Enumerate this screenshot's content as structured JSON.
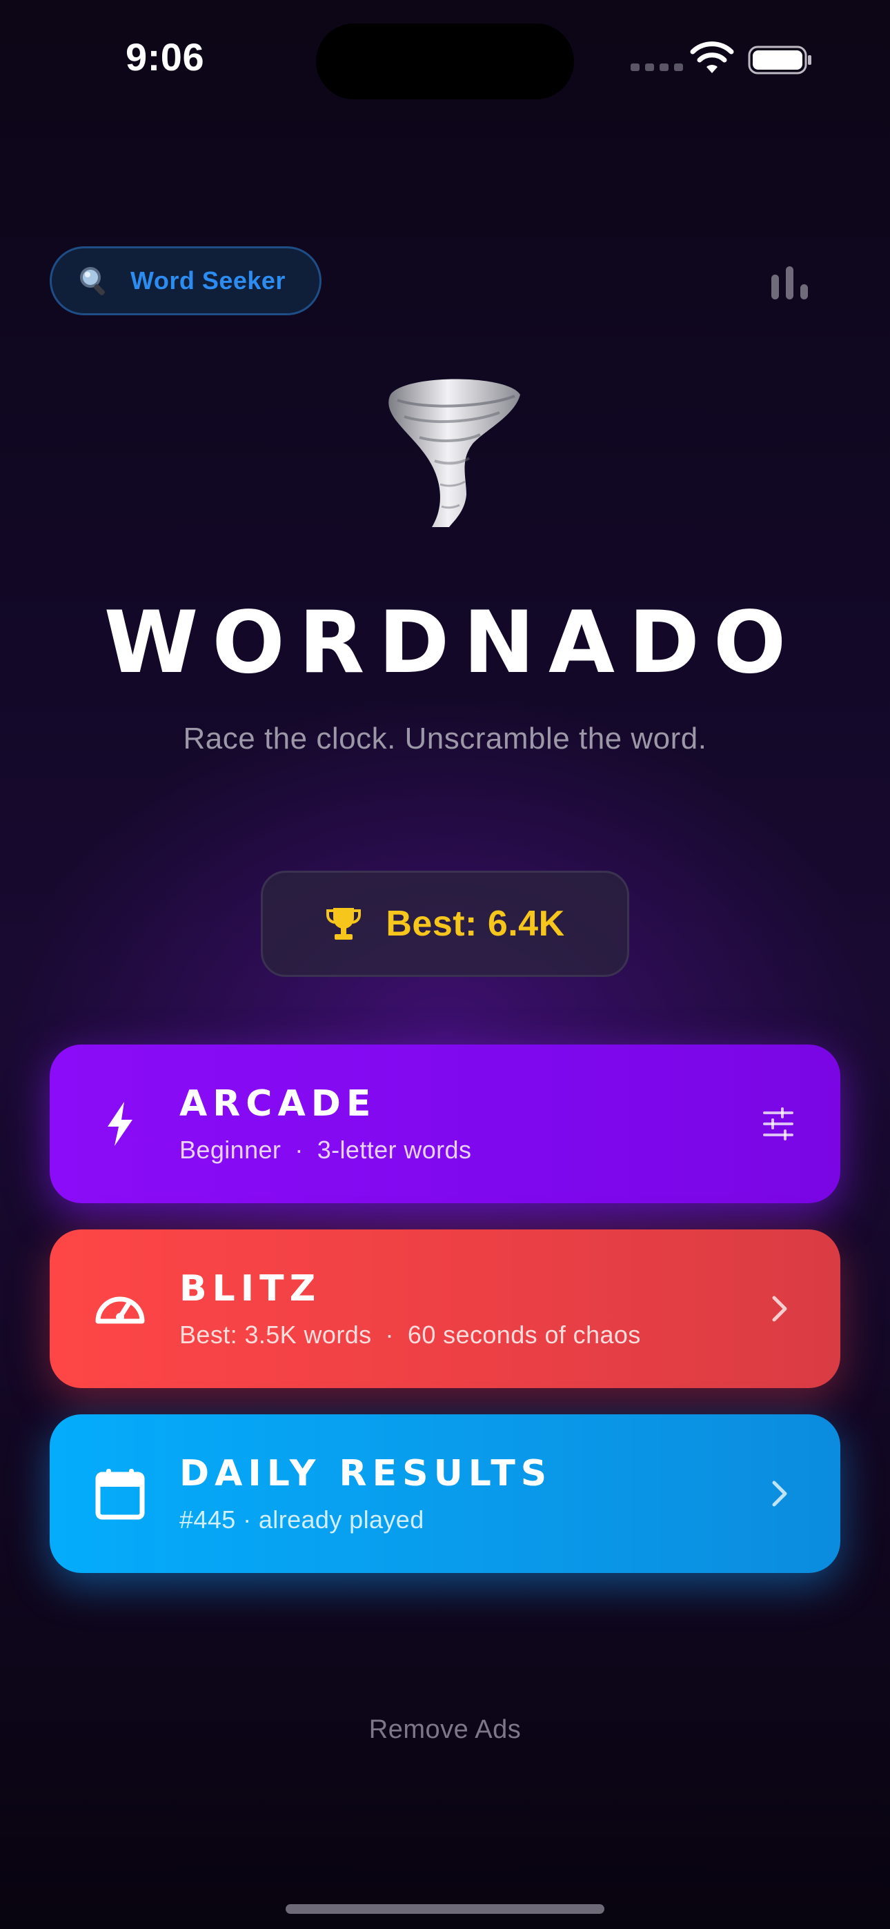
{
  "status_bar": {
    "time": "9:06"
  },
  "header": {
    "word_seeker_label": "Word Seeker",
    "search_icon": "magnifying-glass-icon",
    "stats_icon": "bar-chart-icon",
    "accent_color": "#2c8cf0"
  },
  "hero": {
    "icon": "tornado-icon",
    "title": "WORDNADO",
    "subtitle": "Race the clock. Unscramble the word."
  },
  "best_badge": {
    "icon": "trophy-icon",
    "label": "Best: 6.4K",
    "color": "#f7c61c"
  },
  "modes": [
    {
      "title": "ARCADE",
      "sub_a": "Beginner",
      "separator": "·",
      "sub_b": "3-letter words",
      "icon": "lightning-bolt-icon",
      "action_icon": "sliders-icon",
      "color": "#8b0cf8"
    },
    {
      "title": "BLITZ",
      "sub_a": "Best: 3.5K words",
      "separator": "·",
      "sub_b": "60 seconds of chaos",
      "icon": "speedometer-icon",
      "action_icon": "chevron-right-icon",
      "color": "#fe4646"
    },
    {
      "title": "DAILY RESULTS",
      "sub": "#445 · already played",
      "icon": "calendar-icon",
      "action_icon": "chevron-right-icon",
      "color": "#04acfb"
    }
  ],
  "footer": {
    "remove_ads": "Remove Ads"
  }
}
